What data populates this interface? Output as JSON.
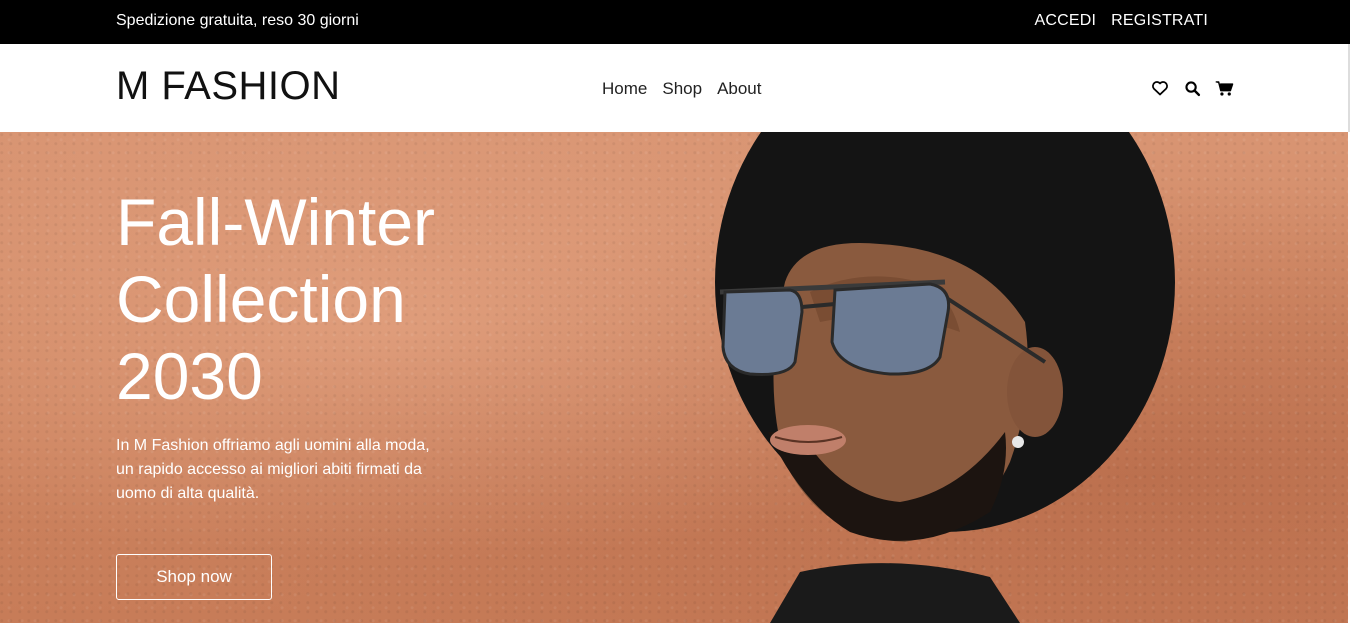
{
  "topbar": {
    "shipping_text": "Spedizione gratuita, reso 30 giorni",
    "login_label": "ACCEDI",
    "register_label": "REGISTRATI"
  },
  "header": {
    "brand": "M FASHION",
    "nav": [
      {
        "label": "Home"
      },
      {
        "label": "Shop"
      },
      {
        "label": "About"
      }
    ],
    "icons": [
      "heart-icon",
      "search-icon",
      "cart-icon"
    ]
  },
  "hero": {
    "title_lines": [
      "Fall-Winter",
      "Collection",
      "2030"
    ],
    "description": "In M Fashion offriamo agli uomini alla moda, un rapido accesso ai migliori abiti firmati da uomo di alta qualità.",
    "cta_label": "Shop now"
  },
  "colors": {
    "topbar_bg": "#000000",
    "hero_bg": "#cf8763",
    "text_on_hero": "#ffffff"
  }
}
